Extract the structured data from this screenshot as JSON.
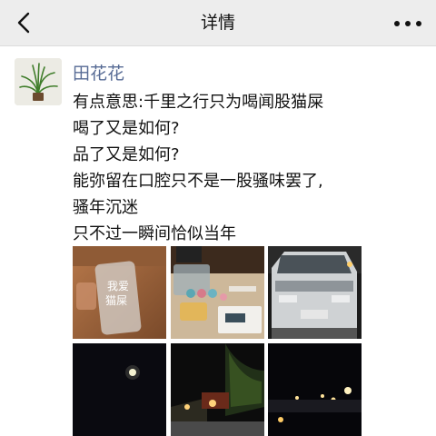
{
  "nav": {
    "title": "详情"
  },
  "post": {
    "author": "田花花",
    "lines": [
      "有点意思:千里之行只为喝闻股猫屎",
      "喝了又是如何?",
      "品了又是如何?",
      "能弥留在口腔只不是一股骚味罢了,",
      "骚年沉迷",
      "只不过一瞬间恰似当年"
    ],
    "photo_sign_text": [
      "我爱",
      "猫屎"
    ]
  },
  "icons": {
    "back": "chevron-left-icon",
    "more": "more-dots-icon"
  },
  "colors": {
    "nav_bg": "#ededed",
    "author_link": "#576b95",
    "text": "#111111"
  }
}
